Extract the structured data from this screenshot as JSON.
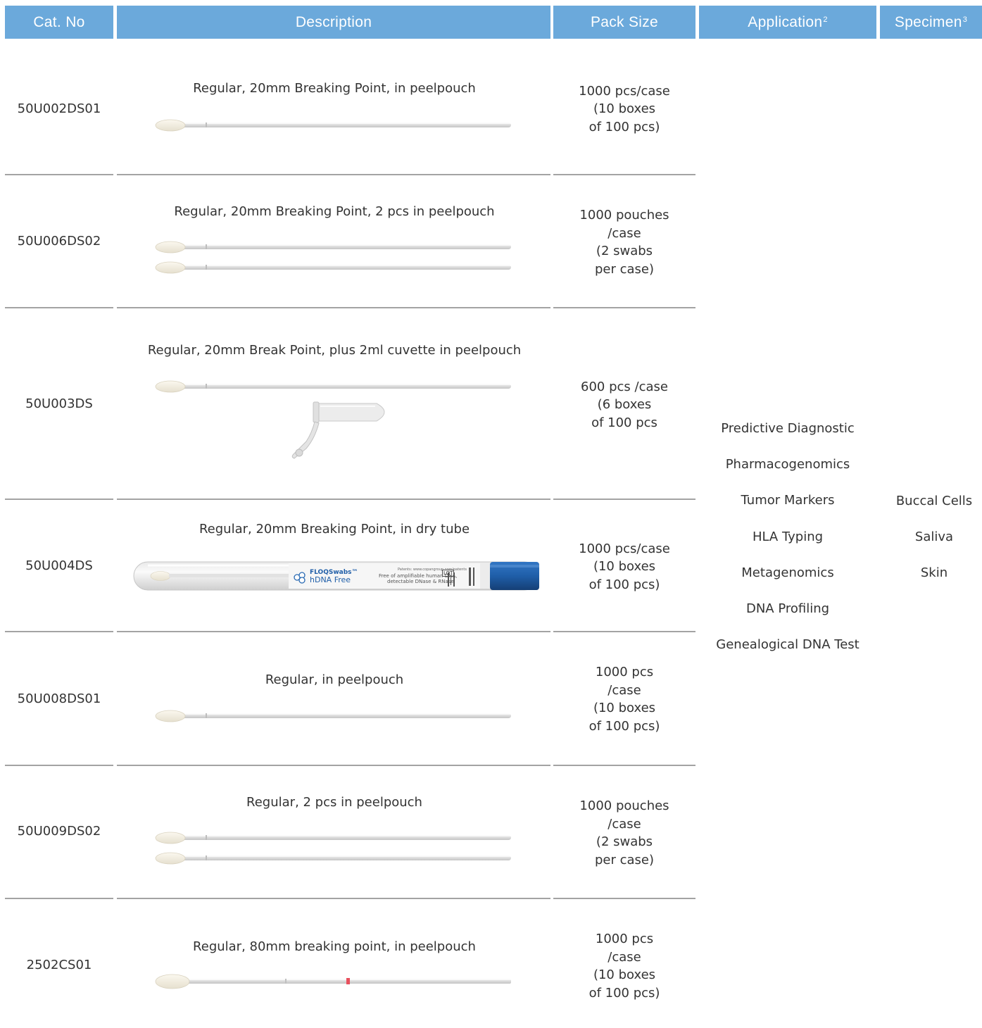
{
  "header": {
    "cat_no": "Cat. No",
    "description": "Description",
    "pack_size": "Pack Size",
    "application": "Application",
    "application_sup": "2",
    "specimen": "Specimen",
    "specimen_sup": "3"
  },
  "colors": {
    "header_bg": "#6ba9db",
    "separator": "#a3a3a3",
    "tube_cap": "#1f5ea8"
  },
  "rows": [
    {
      "cat_no": "50U002DS01",
      "description": "Regular, 20mm Breaking Point, in peelpouch",
      "pack": [
        "1000 pcs/case",
        "(10 boxes",
        "of 100 pcs)"
      ]
    },
    {
      "cat_no": "50U006DS02",
      "description": "Regular, 20mm Breaking Point, 2 pcs in peelpouch",
      "pack": [
        "1000 pouches",
        "/case",
        "(2 swabs",
        "per case)"
      ]
    },
    {
      "cat_no": "50U003DS",
      "description": "Regular, 20mm Break Point, plus 2ml cuvette in peelpouch",
      "pack": [
        "600 pcs /case",
        "(6 boxes",
        "of 100 pcs"
      ]
    },
    {
      "cat_no": "50U004DS",
      "description": "Regular, 20mm Breaking Point, in dry tube",
      "pack": [
        "1000 pcs/case",
        "(10 boxes",
        "of 100 pcs)"
      ]
    },
    {
      "cat_no": "50U008DS01",
      "description": "Regular, in peelpouch",
      "pack": [
        "1000 pcs",
        "/case",
        "(10 boxes",
        "of 100 pcs)"
      ]
    },
    {
      "cat_no": "50U009DS02",
      "description": "Regular, 2 pcs in peelpouch",
      "pack": [
        "1000 pouches",
        "/case",
        "(2 swabs",
        "per case)"
      ]
    },
    {
      "cat_no": "2502CS01",
      "description": "Regular, 80mm breaking point, in peelpouch",
      "pack": [
        "1000 pcs",
        "/case",
        "(10 boxes",
        "of 100 pcs)"
      ]
    }
  ],
  "applications": [
    "Predictive Diagnostic",
    "Pharmacogenomics",
    "Tumor Markers",
    "HLA Typing",
    "Metagenomics",
    "DNA Profiling",
    "Genealogical DNA Test"
  ],
  "specimens": [
    "Buccal Cells",
    "Saliva",
    "Skin"
  ],
  "tube_label": {
    "brand": "FLOQSwabs",
    "tm": "™",
    "product": "hDNA Free",
    "claim_1": "Free of amplifiable human DNA,",
    "claim_2": "detectable DNase & RNase",
    "patents": "Patents: www.copangroup.com/patents",
    "lot": "LOT"
  }
}
